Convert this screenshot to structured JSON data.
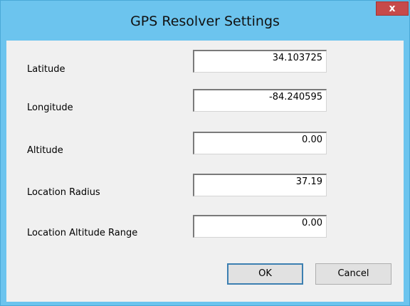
{
  "window": {
    "title": "GPS Resolver Settings",
    "close_label": "x"
  },
  "fields": [
    {
      "label": "Latitude",
      "value": "34.103725"
    },
    {
      "label": "Longitude",
      "value": "-84.240595"
    },
    {
      "label": "Altitude",
      "value": "0.00"
    },
    {
      "label": "Location Radius",
      "value": "37.19"
    },
    {
      "label": "Location Altitude Range",
      "value": "0.00"
    }
  ],
  "buttons": {
    "ok_label": "OK",
    "cancel_label": "Cancel"
  },
  "colors": {
    "titlebar": "#6cc4ee",
    "close_button": "#c74a4a",
    "client_background": "#f0f0f0"
  }
}
